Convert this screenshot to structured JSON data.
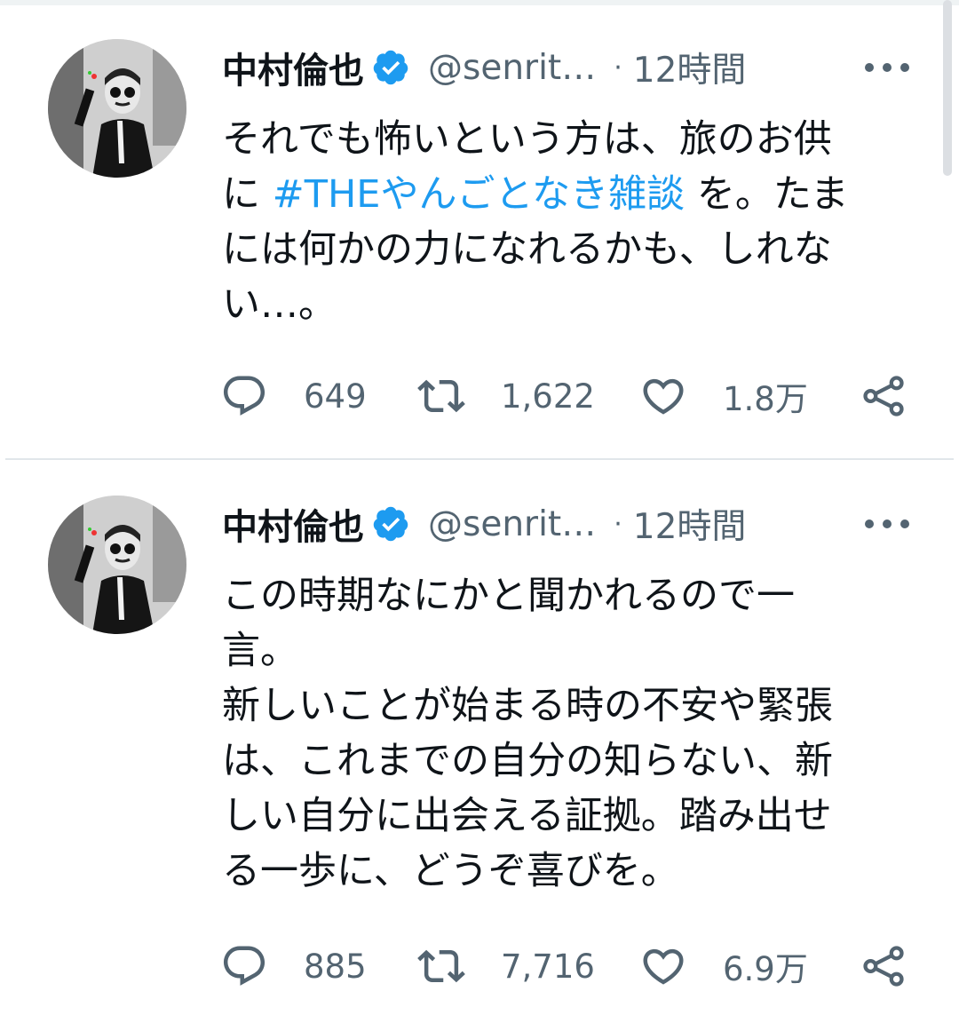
{
  "colors": {
    "link": "#1d9bf0",
    "muted": "#536471",
    "text": "#0f1419",
    "divider": "#e1e6ea"
  },
  "tweets": [
    {
      "author_name": "中村倫也",
      "handle": "@senrit…",
      "separator": "·",
      "time": "12時間",
      "verified_icon": "verified-badge-icon",
      "body_lines": [
        {
          "before": "それでも怖いという方は、旅のお供",
          "hashtag": "",
          "after": ""
        },
        {
          "before": "に ",
          "hashtag": "#THEやんごとなき雑談",
          "after": " を。たま"
        },
        {
          "before": "には何かの力になれるかも、しれな",
          "hashtag": "",
          "after": ""
        },
        {
          "before": "い…。",
          "hashtag": "",
          "after": ""
        }
      ],
      "replies": "649",
      "retweets": "1,622",
      "likes": "1.8万"
    },
    {
      "author_name": "中村倫也",
      "handle": "@senrit…",
      "separator": "·",
      "time": "12時間",
      "verified_icon": "verified-badge-icon",
      "body_lines": [
        {
          "before": "この時期なにかと聞かれるので一",
          "hashtag": "",
          "after": ""
        },
        {
          "before": "言。",
          "hashtag": "",
          "after": ""
        },
        {
          "before": "新しいことが始まる時の不安や緊張",
          "hashtag": "",
          "after": ""
        },
        {
          "before": "は、これまでの自分の知らない、新",
          "hashtag": "",
          "after": ""
        },
        {
          "before": "しい自分に出会える証拠。踏み出せ",
          "hashtag": "",
          "after": ""
        },
        {
          "before": "る一歩に、どうぞ喜びを。",
          "hashtag": "",
          "after": ""
        }
      ],
      "replies": "885",
      "retweets": "7,716",
      "likes": "6.9万"
    }
  ],
  "icons": {
    "reply": "reply-bubble-icon",
    "retweet": "retweet-icon",
    "like": "heart-icon",
    "share": "share-icon",
    "more": "more-options-icon"
  }
}
